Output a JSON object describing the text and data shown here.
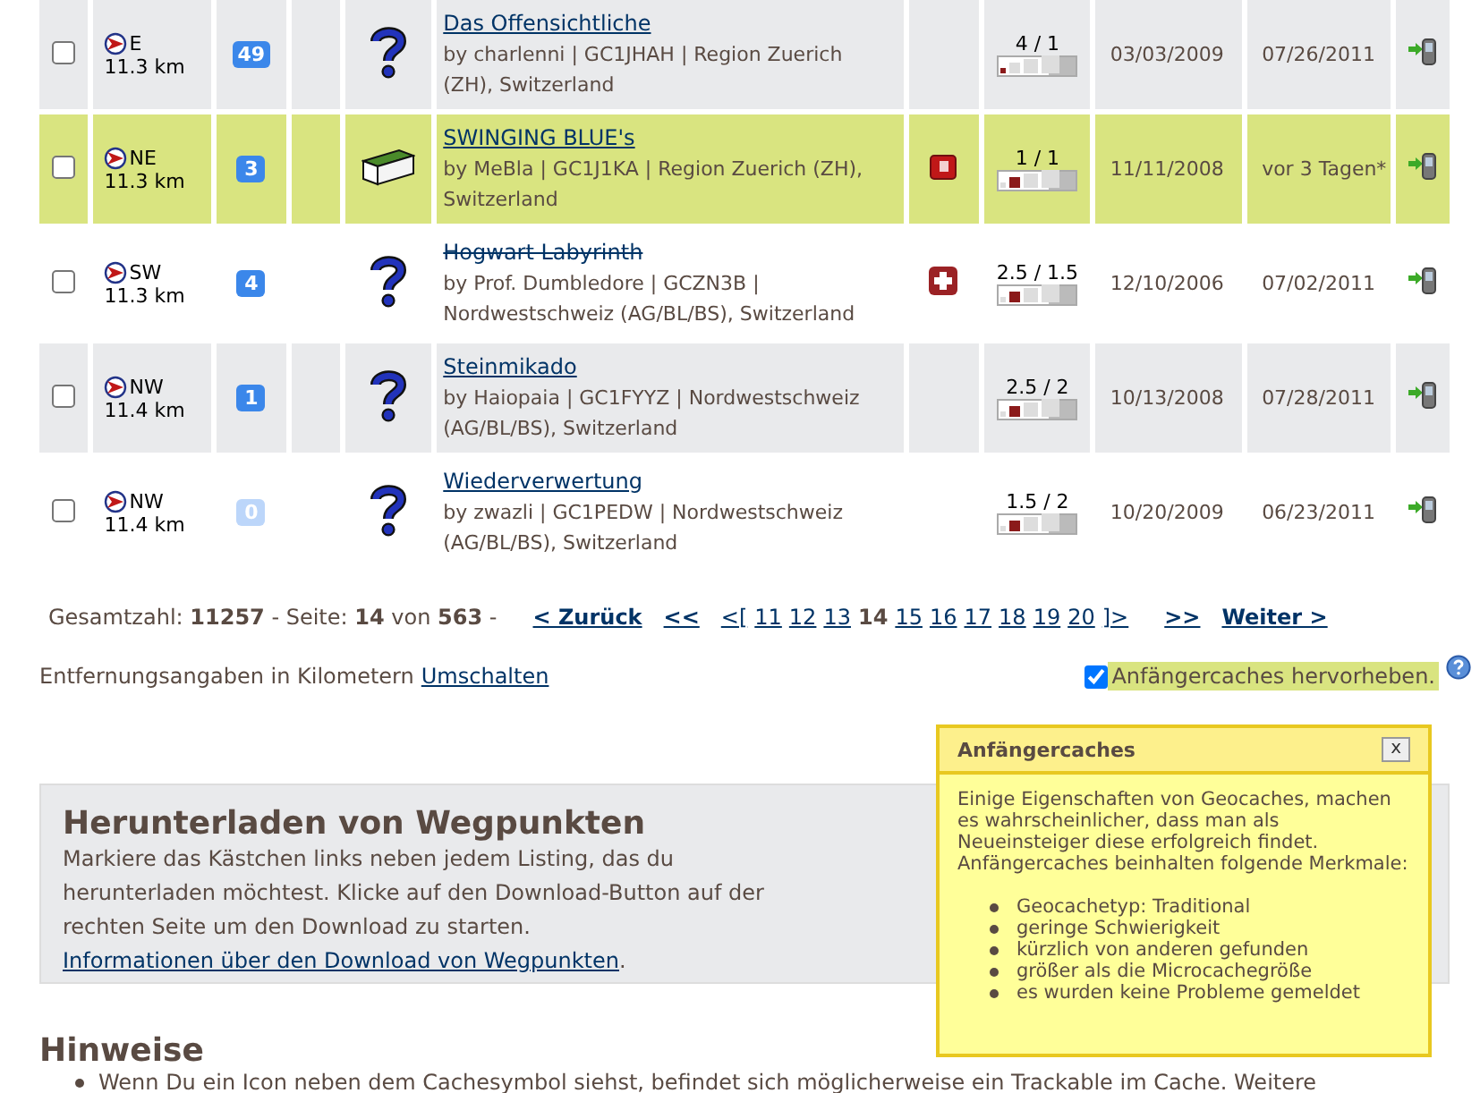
{
  "results": {
    "rows": [
      {
        "checked": false,
        "shaded": true,
        "highlighted": false,
        "direction": "E",
        "distance": "11.3 km",
        "favorites": "49",
        "favorites_muted": false,
        "type_icon": {
          "kind": "mystery"
        },
        "title": "Das Offensichtliche",
        "disabled": false,
        "details": "by charlenni | GC1JHAH | Region Zuerich (ZH), Switzerland",
        "rating": "4 / 1",
        "size": {
          "kind": "micro"
        },
        "hidden": "03/03/2009",
        "last_found": "07/26/2011"
      },
      {
        "checked": false,
        "shaded": false,
        "highlighted": true,
        "direction": "NE",
        "distance": "11.3 km",
        "favorites": "3",
        "favorites_muted": false,
        "type_icon": {
          "kind": "traditional"
        },
        "title": "SWINGING BLUE's",
        "disabled": false,
        "details": "by MeBla | GC1J1KA | Region Zuerich (ZH), Switzerland",
        "extra_icon": {
          "kind": "trackable"
        },
        "rating": "1 / 1",
        "size": {
          "kind": "small"
        },
        "hidden": "11/11/2008",
        "last_found": "vor 3 Tagen*"
      },
      {
        "checked": false,
        "shaded": false,
        "highlighted": false,
        "direction": "SW",
        "distance": "11.3 km",
        "favorites": "4",
        "favorites_muted": false,
        "type_icon": {
          "kind": "mystery"
        },
        "title": "Hogwart Labyrinth",
        "disabled": true,
        "details": "by Prof. Dumbledore | GCZN3B | Nordwestschweiz (AG/BL/BS), Switzerland",
        "extra_icon": {
          "kind": "cross"
        },
        "rating": "2.5 / 1.5",
        "size": {
          "kind": "small"
        },
        "hidden": "12/10/2006",
        "last_found": "07/02/2011"
      },
      {
        "checked": false,
        "shaded": true,
        "highlighted": false,
        "direction": "NW",
        "distance": "11.4 km",
        "favorites": "1",
        "favorites_muted": false,
        "type_icon": {
          "kind": "mystery"
        },
        "title": "Steinmikado",
        "disabled": false,
        "details": "by Haiopaia | GC1FYYZ | Nordwestschweiz (AG/BL/BS), Switzerland",
        "rating": "2.5 / 2",
        "size": {
          "kind": "small"
        },
        "hidden": "10/13/2008",
        "last_found": "07/28/2011"
      },
      {
        "checked": false,
        "shaded": false,
        "highlighted": false,
        "direction": "NW",
        "distance": "11.4 km",
        "favorites": "0",
        "favorites_muted": true,
        "type_icon": {
          "kind": "mystery"
        },
        "title": "Wiederverwertung",
        "disabled": false,
        "details": "by zwazli | GC1PEDW | Nordwestschweiz (AG/BL/BS), Switzerland",
        "rating": "1.5 / 2",
        "size": {
          "kind": "small"
        },
        "hidden": "10/20/2009",
        "last_found": "06/23/2011"
      }
    ]
  },
  "pagination": {
    "summary": "Gesamtzahl: **11257** - Seite: **14** von **563** -",
    "prev_links": [
      {
        "label": "< Zurück"
      },
      {
        "label": "<<"
      }
    ],
    "open": "<[",
    "pages": [
      {
        "label": "11",
        "selected": false
      },
      {
        "label": "12",
        "selected": false
      },
      {
        "label": "13",
        "selected": false
      },
      {
        "label": "14",
        "selected": true
      },
      {
        "label": "15",
        "selected": false
      },
      {
        "label": "16",
        "selected": false
      },
      {
        "label": "17",
        "selected": false
      },
      {
        "label": "18",
        "selected": false
      },
      {
        "label": "19",
        "selected": false
      },
      {
        "label": "20",
        "selected": false
      }
    ],
    "close": "]>",
    "next_links": [
      {
        "label": ">>"
      },
      {
        "label": "Weiter >"
      }
    ]
  },
  "distance_note": {
    "text": "Entfernungsangaben in Kilometern",
    "link": "Umschalten"
  },
  "beginner_toggle": {
    "label": "Anfängercaches hervorheben.",
    "checked": true
  },
  "tooltip": {
    "title": "Anfängercaches",
    "close": "x",
    "text": "Einige Eigenschaften von Geocaches, machen es wahrscheinlicher, dass man als Neueinsteiger diese erfolgreich findet. Anfängercaches beinhalten folgende Merkmale:",
    "items": [
      "Geocachetyp: Traditional",
      "geringe Schwierigkeit",
      "kürzlich von anderen gefunden",
      "größer als die Microcachegröße",
      "es wurden keine Probleme gemeldet"
    ]
  },
  "download_panel": {
    "title": "Herunterladen von Wegpunkten",
    "text": "Markiere das Kästchen links neben jedem Listing, das du herunterladen möchtest. Klicke auf den Download-Button auf der rechten Seite um den Download zu starten.",
    "link": "Informationen über den Download von Wegpunkten",
    "end": "."
  },
  "hints": {
    "title": "Hinweise",
    "items": [
      "Wenn Du ein Icon neben dem Cachesymbol siehst, befindet sich möglicherweise ein Trackable im Cache. Weitere"
    ]
  }
}
